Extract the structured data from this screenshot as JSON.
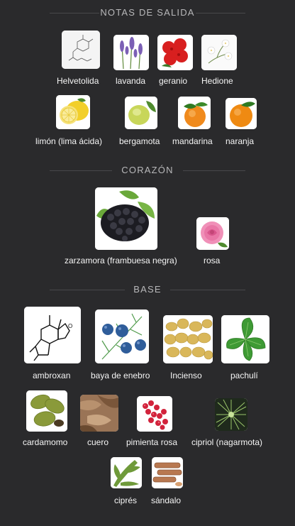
{
  "sections": {
    "top": {
      "title": "NOTAS DE SALIDA"
    },
    "heart": {
      "title": "CORAZÓN"
    },
    "base": {
      "title": "BASE"
    }
  },
  "notes": {
    "helvetolida": "Helvetolida",
    "lavanda": "lavanda",
    "geranio": "geranio",
    "hedione": "Hedione",
    "limon": "limón (lima ácida)",
    "bergamota": "bergamota",
    "mandarina": "mandarina",
    "naranja": "naranja",
    "zarzamora": "zarzamora (frambuesa negra)",
    "rosa": "rosa",
    "ambroxan": "ambroxan",
    "enebro": "baya de enebro",
    "incienso": "Incienso",
    "pachuli": "pachulí",
    "cardamomo": "cardamomo",
    "cuero": "cuero",
    "pimienta": "pimienta rosa",
    "cipriol": "cipriol (nagarmota)",
    "cipres": "ciprés",
    "sandalo": "sándalo"
  }
}
